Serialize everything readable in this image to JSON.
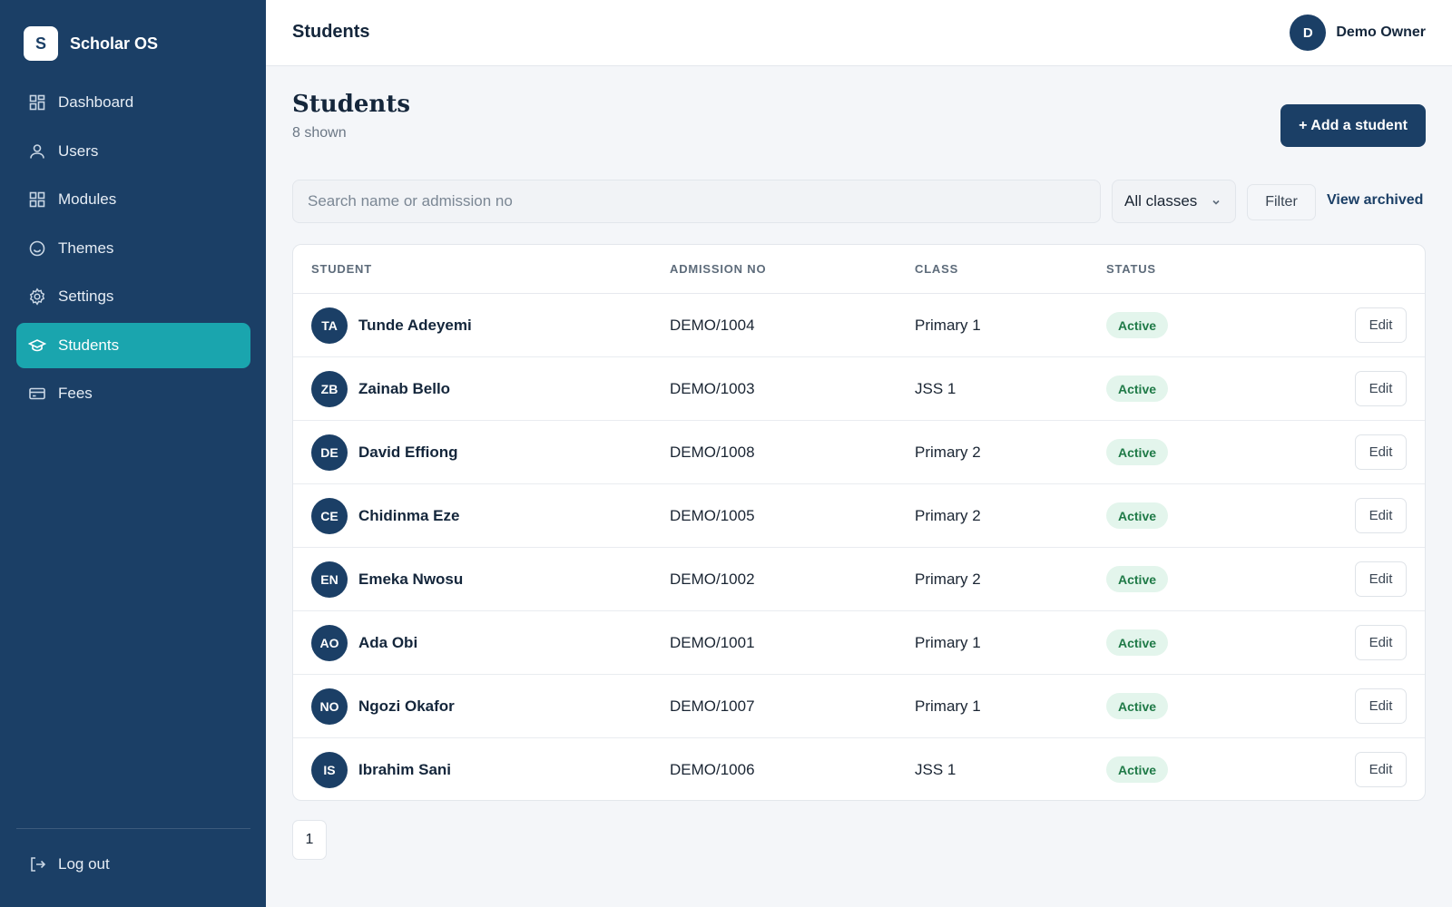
{
  "brand": {
    "logo_letter": "S",
    "name": "Scholar OS"
  },
  "sidebar": {
    "items": [
      {
        "label": "Dashboard",
        "icon": "grid-icon"
      },
      {
        "label": "Users",
        "icon": "user-icon"
      },
      {
        "label": "Modules",
        "icon": "grid-icon"
      },
      {
        "label": "Themes",
        "icon": "palette-icon"
      },
      {
        "label": "Settings",
        "icon": "gear-icon"
      },
      {
        "label": "Students",
        "icon": "graduation-cap-icon",
        "active": true
      },
      {
        "label": "Fees",
        "icon": "credit-card-icon"
      }
    ],
    "logout_label": "Log out"
  },
  "header": {
    "title": "Students",
    "user": {
      "initial": "D",
      "name": "Demo Owner"
    }
  },
  "main": {
    "heading": "Students",
    "subheading": "8 shown",
    "add_label": "+ Add a student",
    "search_placeholder": "Search name or admission no",
    "class_select": "All classes",
    "filter_label": "Filter",
    "view_archived_label": "View archived",
    "page_number": "1"
  },
  "table": {
    "columns": [
      "STUDENT",
      "ADMISSION NO",
      "CLASS",
      "STATUS"
    ],
    "rows": [
      {
        "initials": "TA",
        "name": "Tunde Adeyemi",
        "admission": "DEMO/1004",
        "class": "Primary 1",
        "status": "Active",
        "action": "Edit"
      },
      {
        "initials": "ZB",
        "name": "Zainab Bello",
        "admission": "DEMO/1003",
        "class": "JSS 1",
        "status": "Active",
        "action": "Edit"
      },
      {
        "initials": "DE",
        "name": "David Effiong",
        "admission": "DEMO/1008",
        "class": "Primary 2",
        "status": "Active",
        "action": "Edit"
      },
      {
        "initials": "CE",
        "name": "Chidinma Eze",
        "admission": "DEMO/1005",
        "class": "Primary 2",
        "status": "Active",
        "action": "Edit"
      },
      {
        "initials": "EN",
        "name": "Emeka Nwosu",
        "admission": "DEMO/1002",
        "class": "Primary 2",
        "status": "Active",
        "action": "Edit"
      },
      {
        "initials": "AO",
        "name": "Ada Obi",
        "admission": "DEMO/1001",
        "class": "Primary 1",
        "status": "Active",
        "action": "Edit"
      },
      {
        "initials": "NO",
        "name": "Ngozi Okafor",
        "admission": "DEMO/1007",
        "class": "Primary 1",
        "status": "Active",
        "action": "Edit"
      },
      {
        "initials": "IS",
        "name": "Ibrahim Sani",
        "admission": "DEMO/1006",
        "class": "JSS 1",
        "status": "Active",
        "action": "Edit"
      }
    ]
  },
  "colors": {
    "sidebar_bg": "#1b3f66",
    "accent": "#1aa5ae",
    "primary": "#1b3f66",
    "status_active_bg": "#e3f5ec",
    "status_active_text": "#1f7a47"
  }
}
